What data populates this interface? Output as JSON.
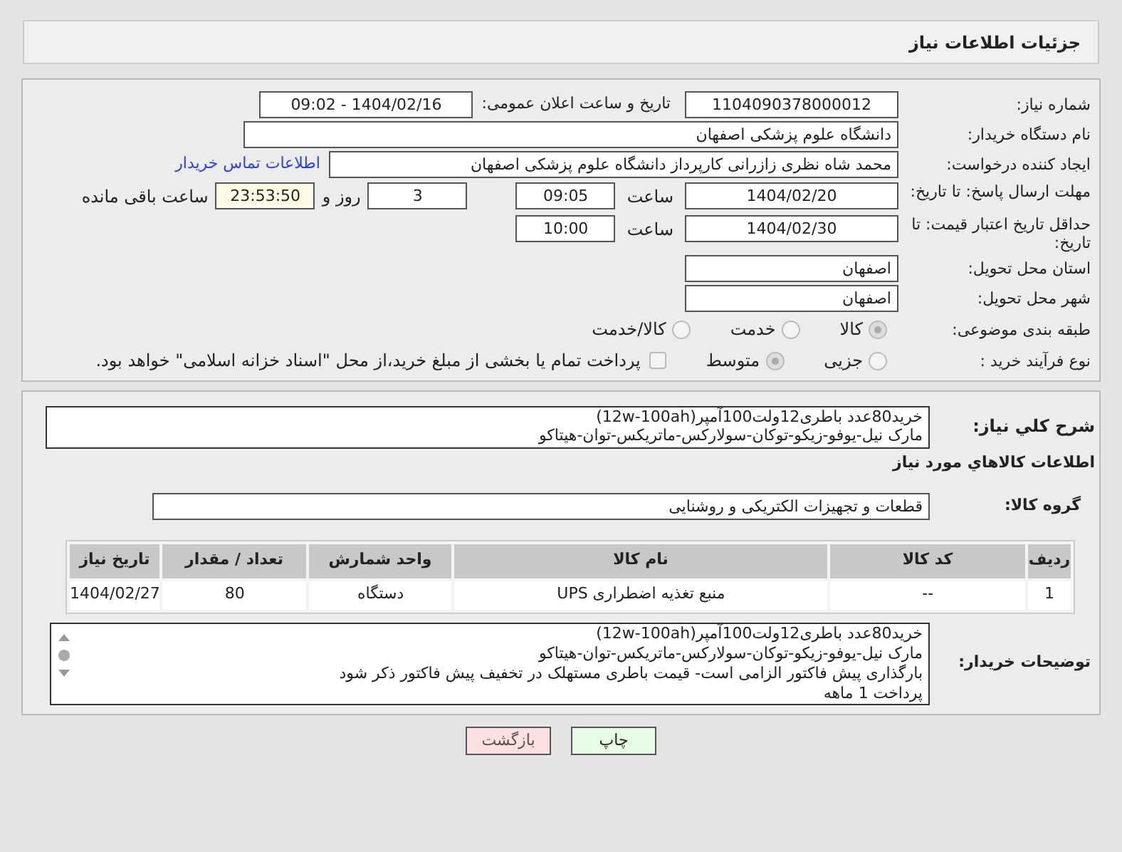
{
  "header": {
    "title": "جزئیات اطلاعات نیاز"
  },
  "need_number": {
    "label": "شماره نیاز:",
    "value": "1104090378000012"
  },
  "announce": {
    "label": "تاریخ و ساعت اعلان عمومی:",
    "value": "1404/02/16 - 09:02"
  },
  "buyer_org": {
    "label": "نام دستگاه خریدار:",
    "value": "دانشگاه علوم پزشکی اصفهان"
  },
  "creator": {
    "label": "ایجاد کننده درخواست:",
    "value": "محمد شاه نظری زازرانی کارپرداز دانشگاه علوم پزشکی اصفهان",
    "link": "اطلاعات تماس خریدار"
  },
  "deadline": {
    "label": "مهلت ارسال پاسخ: تا تاریخ:",
    "date": "1404/02/20",
    "time_label": "ساعت",
    "time": "09:05",
    "days": "3",
    "days_label": "روز و",
    "remaining": "23:53:50",
    "remaining_label": "ساعت باقی مانده"
  },
  "validity": {
    "label": "حداقل تاریخ اعتبار قیمت: تا تاریخ:",
    "date": "1404/02/30",
    "time_label": "ساعت",
    "time": "10:00"
  },
  "province": {
    "label": "استان محل تحویل:",
    "value": "اصفهان"
  },
  "city": {
    "label": "شهر محل تحویل:",
    "value": "اصفهان"
  },
  "category": {
    "label": "طبقه بندی موضوعی:",
    "options": [
      {
        "label": "کالا",
        "selected": true
      },
      {
        "label": "خدمت",
        "selected": false
      },
      {
        "label": "کالا/خدمت",
        "selected": false
      }
    ]
  },
  "process": {
    "label": "نوع فرآیند خرید :",
    "options": [
      {
        "label": "جزیی",
        "selected": false
      },
      {
        "label": "متوسط",
        "selected": true
      }
    ],
    "treasury": {
      "label": "پرداخت تمام یا بخشی از مبلغ خرید،از محل \"اسناد خزانه اسلامی\" خواهد بود.",
      "checked": false
    }
  },
  "description": {
    "label": "شرح کلي نياز:",
    "lines": [
      "خرید80عدد باطری12ولت100آمپر(12w-100ah)",
      "مارک نیل-یوفو-زیکو-توکان-سولارکس-ماتریکس-توان-هیتاکو"
    ]
  },
  "goods_heading": "اطلاعات کالاهاي مورد نياز",
  "goods_group": {
    "label": "گروه کالا:",
    "value": "قطعات و تجهیزات الکتریکی و روشنایی"
  },
  "table": {
    "columns": [
      "ردیف",
      "کد کالا",
      "نام کالا",
      "واحد شمارش",
      "تعداد / مقدار",
      "تاریخ نیاز"
    ],
    "rows": [
      [
        "1",
        "--",
        "منبع تغذیه اضطراری UPS",
        "دستگاه",
        "80",
        "1404/02/27"
      ]
    ]
  },
  "buyer_notes": {
    "label": "توضیحات خریدار:",
    "lines": [
      "خرید80عدد باطری12ولت100آمپر(12w-100ah)",
      "مارک نیل-یوفو-زیکو-توکان-سولارکس-ماتریکس-توان-هیتاکو",
      "بارگذاری پیش فاکتور الزامی است- قیمت باطری مستهلک در تخفیف پیش فاکتور ذکر شود",
      "پرداخت 1 ماهه"
    ]
  },
  "buttons": [
    {
      "kind": "print",
      "label": "چاپ"
    },
    {
      "kind": "back",
      "label": "بازگشت"
    }
  ]
}
